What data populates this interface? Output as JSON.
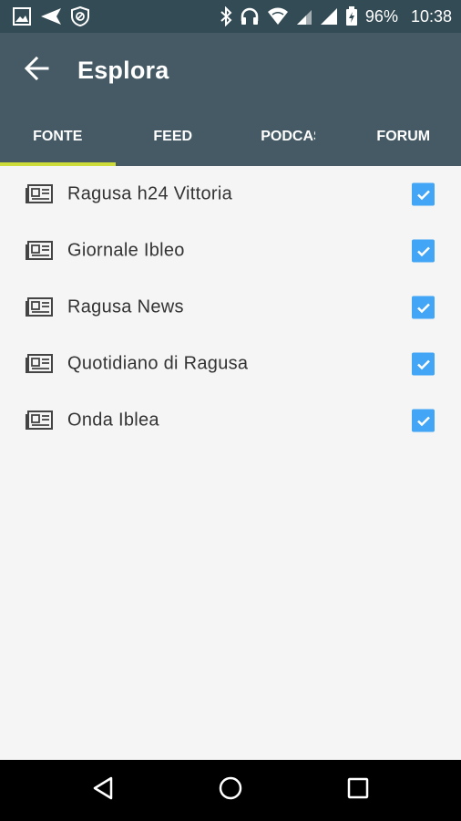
{
  "status_bar": {
    "battery_percent": "96%",
    "time": "10:38",
    "icons": [
      "image-icon",
      "send-icon",
      "shield-icon",
      "bluetooth-icon",
      "headphones-icon",
      "wifi-icon",
      "signal-icon",
      "signal-icon",
      "battery-icon"
    ]
  },
  "app_bar": {
    "title": "Esplora",
    "back_icon": "arrow-back-icon"
  },
  "tabs": [
    {
      "label": "FONTE",
      "active": true
    },
    {
      "label": "FEED",
      "active": false
    },
    {
      "label": "PODCAST",
      "active": false
    },
    {
      "label": "FORUM",
      "active": false
    }
  ],
  "sources": [
    {
      "label": "Ragusa h24 Vittoria",
      "checked": true,
      "icon": "newspaper-icon"
    },
    {
      "label": "Giornale Ibleo",
      "checked": true,
      "icon": "newspaper-icon"
    },
    {
      "label": "Ragusa News",
      "checked": true,
      "icon": "newspaper-icon"
    },
    {
      "label": "Quotidiano di Ragusa",
      "checked": true,
      "icon": "newspaper-icon"
    },
    {
      "label": "Onda Iblea",
      "checked": true,
      "icon": "newspaper-icon"
    }
  ],
  "nav_bar": {
    "icons": [
      "back-triangle-icon",
      "home-circle-icon",
      "recents-square-icon"
    ]
  },
  "colors": {
    "status_bar": "#334b54",
    "app_bar": "#455a64",
    "tab_indicator": "#cddc39",
    "checkbox": "#42a5f5",
    "background": "#f5f5f5"
  }
}
